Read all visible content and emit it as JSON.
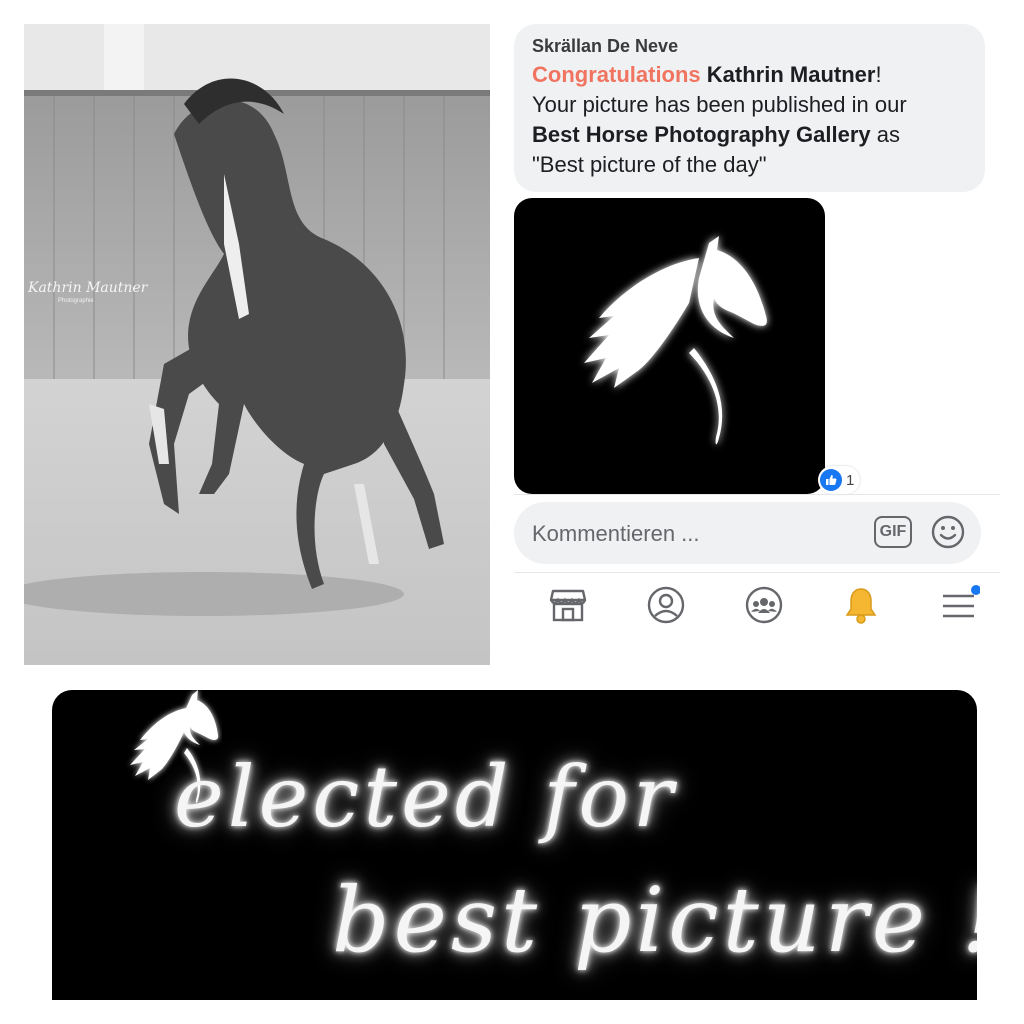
{
  "comment": {
    "author": "Skrällan De Neve",
    "highlight": "Congratulations",
    "recipient": "Kathrin Mautner",
    "exclaim": "!",
    "line2": "Your picture has been published in our",
    "gallery": "Best Horse Photography Gallery",
    "as_word": " as",
    "quote": "\"Best picture of the day\""
  },
  "reaction": {
    "icon": "thumbs-up-icon",
    "count": "1",
    "color": "#1877f2"
  },
  "input": {
    "placeholder": "Kommentieren ...",
    "gif_label": "GIF"
  },
  "nav": {
    "items": [
      "marketplace-icon",
      "profile-icon",
      "groups-icon",
      "notifications-bell-icon",
      "menu-icon"
    ],
    "notification_dot_color": "#1877f2",
    "bell_color": "#f5b631"
  },
  "photo": {
    "watermark": "Kathrin Mautner",
    "watermark_sub": "Photographie"
  },
  "banner": {
    "line1": "elected  for",
    "line2": "best picture !"
  },
  "colors": {
    "highlight": "#f0745f",
    "bubble": "#f0f1f3"
  }
}
